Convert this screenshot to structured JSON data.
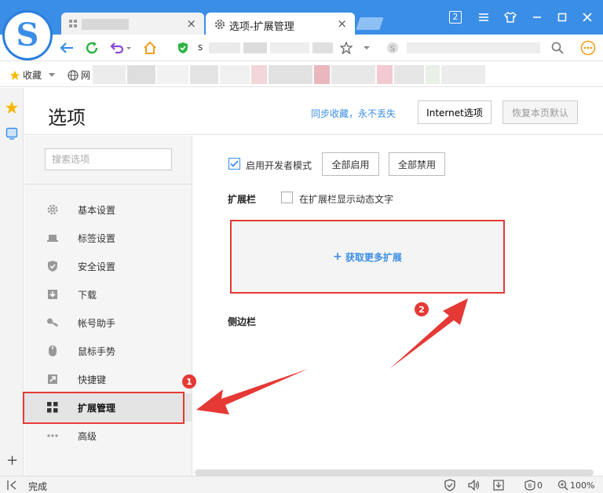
{
  "browser": {
    "logo_letter": "S",
    "active_tab_title": "选项-扩展管理",
    "tab_close": "×",
    "address_prefix": "s",
    "tab_count": "2",
    "accent": "#3a8ee6"
  },
  "bookmarks": {
    "favorites_label": "收藏",
    "web_label": "网"
  },
  "header": {
    "title": "选项",
    "sync_link": "同步收藏，永不丢失",
    "internet_options": "Internet选项",
    "restore_default": "恢复本页默认"
  },
  "sidebar": {
    "search_placeholder": "搜索选项",
    "items": [
      {
        "label": "基本设置",
        "icon": "gear-icon"
      },
      {
        "label": "标签设置",
        "icon": "tab-icon"
      },
      {
        "label": "安全设置",
        "icon": "shield-icon"
      },
      {
        "label": "下载",
        "icon": "download-icon"
      },
      {
        "label": "帐号助手",
        "icon": "key-icon"
      },
      {
        "label": "鼠标手势",
        "icon": "mouse-icon"
      },
      {
        "label": "快捷键",
        "icon": "shortcut-arrow-icon"
      },
      {
        "label": "扩展管理",
        "icon": "grid-icon"
      },
      {
        "label": "高级",
        "icon": "more-dots-icon"
      }
    ],
    "active_index": 7
  },
  "main": {
    "dev_mode_label": "启用开发者模式",
    "dev_mode_checked": true,
    "enable_all": "全部启用",
    "disable_all": "全部禁用",
    "extension_bar_title": "扩展栏",
    "show_dynamic_text_label": "在扩展栏显示动态文字",
    "show_dynamic_text_checked": false,
    "get_more_extensions": "获取更多扩展",
    "get_more_plus": "+",
    "sidebar_section_title": "侧边栏"
  },
  "annotations": {
    "marker_1": "1",
    "marker_2": "2",
    "color": "#e53935"
  },
  "status": {
    "text": "完成",
    "blocked_count": "0",
    "zoom": "100%",
    "add_strip": "+"
  }
}
